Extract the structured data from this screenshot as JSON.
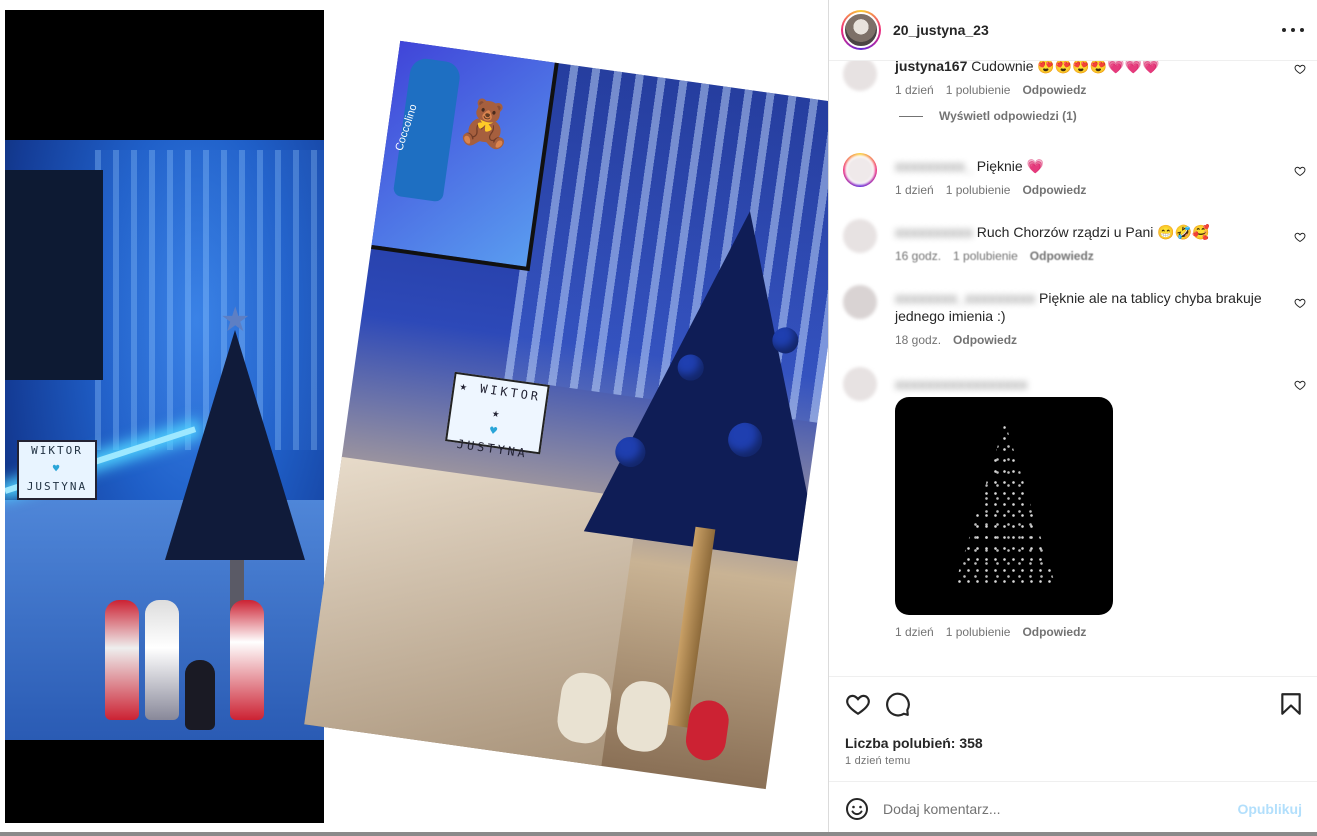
{
  "post": {
    "author": "20_justyna_23",
    "likes_label": "Liczba polubień: 358",
    "posted": "1 dzień temu"
  },
  "media": {
    "photo1_sign": [
      "WIKTOR",
      "♥",
      "JUSTYNA"
    ],
    "photo2_sign": [
      "★ WIKTOR ★",
      "♥",
      "JUSTYNA"
    ],
    "photo2_bottle_label": "Coccolino"
  },
  "comments": [
    {
      "user": "justyna167",
      "text": "Cudownie 😍😍😍😍💗💗💗",
      "time": "1 dzień",
      "likes": "1 polubienie",
      "reply": "Odpowiedz",
      "view_replies": "Wyświetl odpowiedzi (1)"
    },
    {
      "user": "",
      "text": "Pięknie 💗",
      "time": "1 dzień",
      "likes": "1 polubienie",
      "reply": "Odpowiedz"
    },
    {
      "user": "",
      "text": "Ruch Chorzów rządzi u Pani 😁🤣🥰",
      "time": "16 godz.",
      "likes": "1 polubienie",
      "reply": "Odpowiedz"
    },
    {
      "user": "",
      "text": "Pięknie ale na tablicy chyba brakuje jednego imienia :)",
      "time": "18 godz.",
      "reply": "Odpowiedz"
    },
    {
      "user": "",
      "time": "1 dzień",
      "likes": "1 polubienie",
      "reply": "Odpowiedz"
    }
  ],
  "composer": {
    "placeholder": "Dodaj komentarz...",
    "post_label": "Opublikuj"
  },
  "colors": {
    "accent_disabled": "#b2dffc",
    "text": "#262626",
    "muted": "#737373"
  },
  "icons": [
    "more-icon",
    "heart-icon",
    "comment-icon",
    "bookmark-icon",
    "emoji-icon"
  ]
}
